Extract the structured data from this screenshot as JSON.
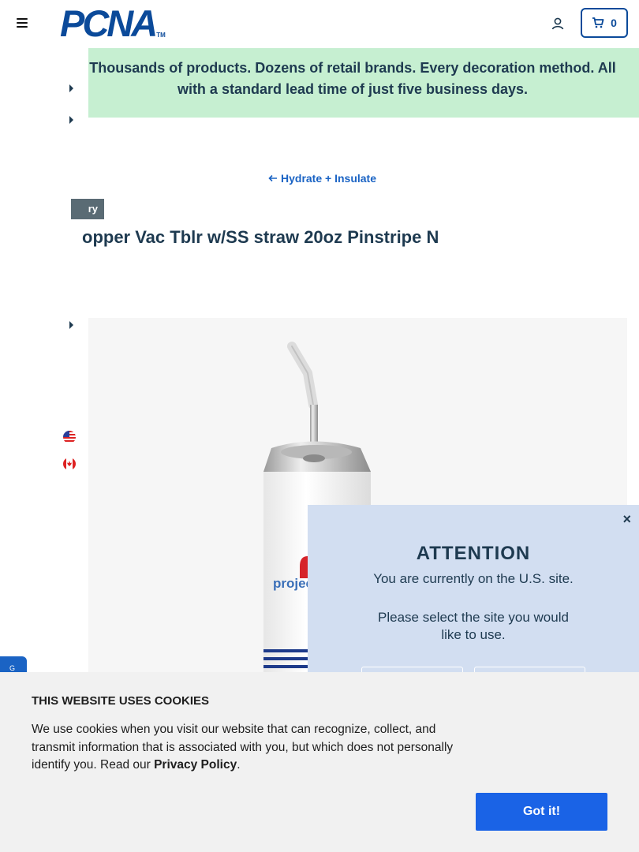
{
  "header": {
    "logo_text": "PCNA",
    "logo_tm": "TM",
    "cart_count": "0",
    "brand_color": "#0b4a9a"
  },
  "banner": {
    "text": "Thousands of products. Dozens of retail brands. Every decoration method. All with a standard lead time of just five business days.",
    "background": "#c6efd1"
  },
  "breadcrumb": {
    "back_label": "Hydrate + Insulate"
  },
  "product": {
    "tag": "ry",
    "title": "opper Vac Tblr w/SS straw 20oz Pinstripe N",
    "imprint_text": "projec"
  },
  "attention": {
    "close": "×",
    "title": "ATTENTION",
    "line1": "You are currently on the U.S. site.",
    "line2": "Please select the site you would like to use."
  },
  "chat_tab": {
    "label": "G"
  },
  "cookie": {
    "title": "THIS WEBSITE USES COOKIES",
    "body_prefix": "We use cookies when you visit our website that can recognize, collect, and transmit information that is associated with you, but which does not personally identify you. Read our ",
    "privacy_link": "Privacy Policy",
    "body_suffix": ".",
    "button": "Got it!"
  }
}
